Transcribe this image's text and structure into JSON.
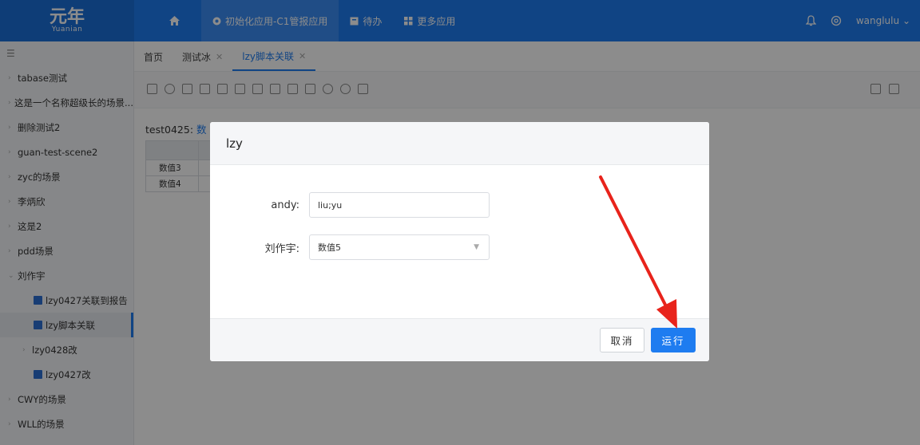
{
  "brand": {
    "logo_cn": "元年",
    "logo_en": "Yuanian"
  },
  "topnav": {
    "items": [
      {
        "label": "初始化应用-C1管报应用"
      },
      {
        "label": "待办"
      },
      {
        "label": "更多应用"
      }
    ],
    "user": "wanglulu"
  },
  "sidebar": {
    "items": [
      {
        "label": "tabase测试"
      },
      {
        "label": "这是一个名称超级长的场景..."
      },
      {
        "label": "删除测试2"
      },
      {
        "label": "guan-test-scene2"
      },
      {
        "label": "zyc的场景"
      },
      {
        "label": "李炳欣"
      },
      {
        "label": "这是2"
      },
      {
        "label": "pdd场景"
      },
      {
        "label": "刘作宇"
      },
      {
        "label": "lzy0427关联到报告"
      },
      {
        "label": "lzy脚本关联"
      },
      {
        "label": "lzy0428改"
      },
      {
        "label": "lzy0427改"
      },
      {
        "label": "CWY的场景"
      },
      {
        "label": "WLL的场景"
      }
    ]
  },
  "tabs": [
    {
      "label": "首页"
    },
    {
      "label": "测试冰"
    },
    {
      "label": "lzy脚本关联"
    }
  ],
  "report": {
    "title_prefix": "test0425:",
    "title_highlight": "数",
    "rows": [
      "数值3",
      "数值4"
    ]
  },
  "modal": {
    "title": "lzy",
    "fields": [
      {
        "label": "andy:",
        "value": "liu;yu"
      },
      {
        "label": "刘作宇:",
        "value": "数值5"
      }
    ],
    "cancel_label": "取消",
    "run_label": "运行"
  },
  "colors": {
    "primary": "#1e7cf0",
    "annotation_arrow": "#e8231b"
  }
}
